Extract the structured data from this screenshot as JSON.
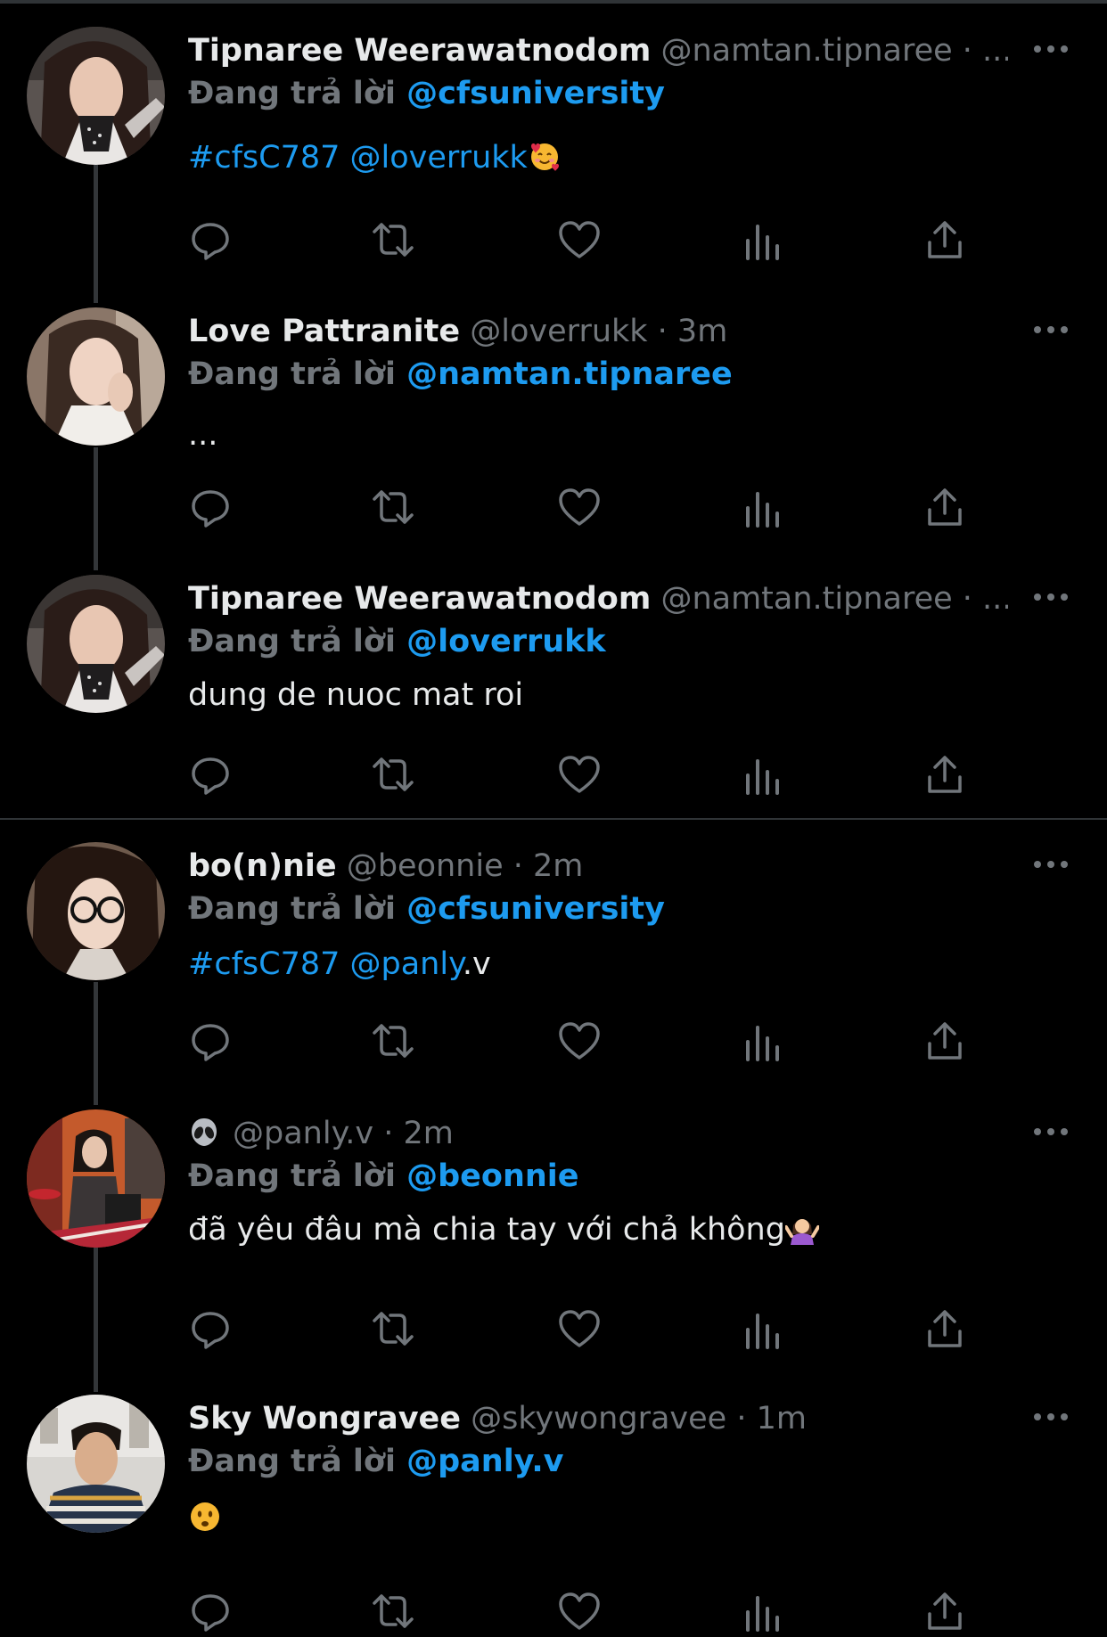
{
  "reply_prefix": "Đang trả lời",
  "tweets": [
    {
      "display_name": "Tipnaree Weerawatnodom",
      "meta": "@namtan.tipnaree · ...",
      "reply_to": "@cfsuniversity",
      "text_hashtag": "#cfsC787",
      "text_mention": "@loverrukk",
      "text_plain": "",
      "emoji": "smiling-face-with-hearts"
    },
    {
      "display_name": "Love Pattranite",
      "meta": "@loverrukk · 3m",
      "reply_to": "@namtan.tipnaree",
      "text_plain": "..."
    },
    {
      "display_name": "Tipnaree Weerawatnodom",
      "meta": "@namtan.tipnaree · ...",
      "reply_to": "@loverrukk",
      "text_plain": "dung de nuoc mat roi"
    },
    {
      "display_name": "bo(n)nie",
      "meta": "@beonnie · 2m",
      "reply_to": "@cfsuniversity",
      "text_hashtag": "#cfsC787",
      "text_mention": "@panly",
      "text_plain": ".v"
    },
    {
      "display_name": "",
      "name_emoji": "alien-emoji",
      "meta": "@panly.v · 2m",
      "reply_to": "@beonnie",
      "text_plain": "đã yêu đâu mà chia tay với chả không",
      "emoji": "shrugging-person"
    },
    {
      "display_name": "Sky Wongravee",
      "meta": "@skywongravee · 1m",
      "reply_to": "@panly.v",
      "text_plain": "",
      "emoji": "frowning-face"
    }
  ],
  "icons": [
    "reply-icon",
    "retweet-icon",
    "like-icon",
    "views-icon",
    "share-icon",
    "more-icon"
  ],
  "colors": {
    "background": "#000000",
    "primary_text": "#e7e9ea",
    "secondary_text": "#71767b",
    "accent": "#1d9bf0",
    "divider": "#2f3336"
  }
}
